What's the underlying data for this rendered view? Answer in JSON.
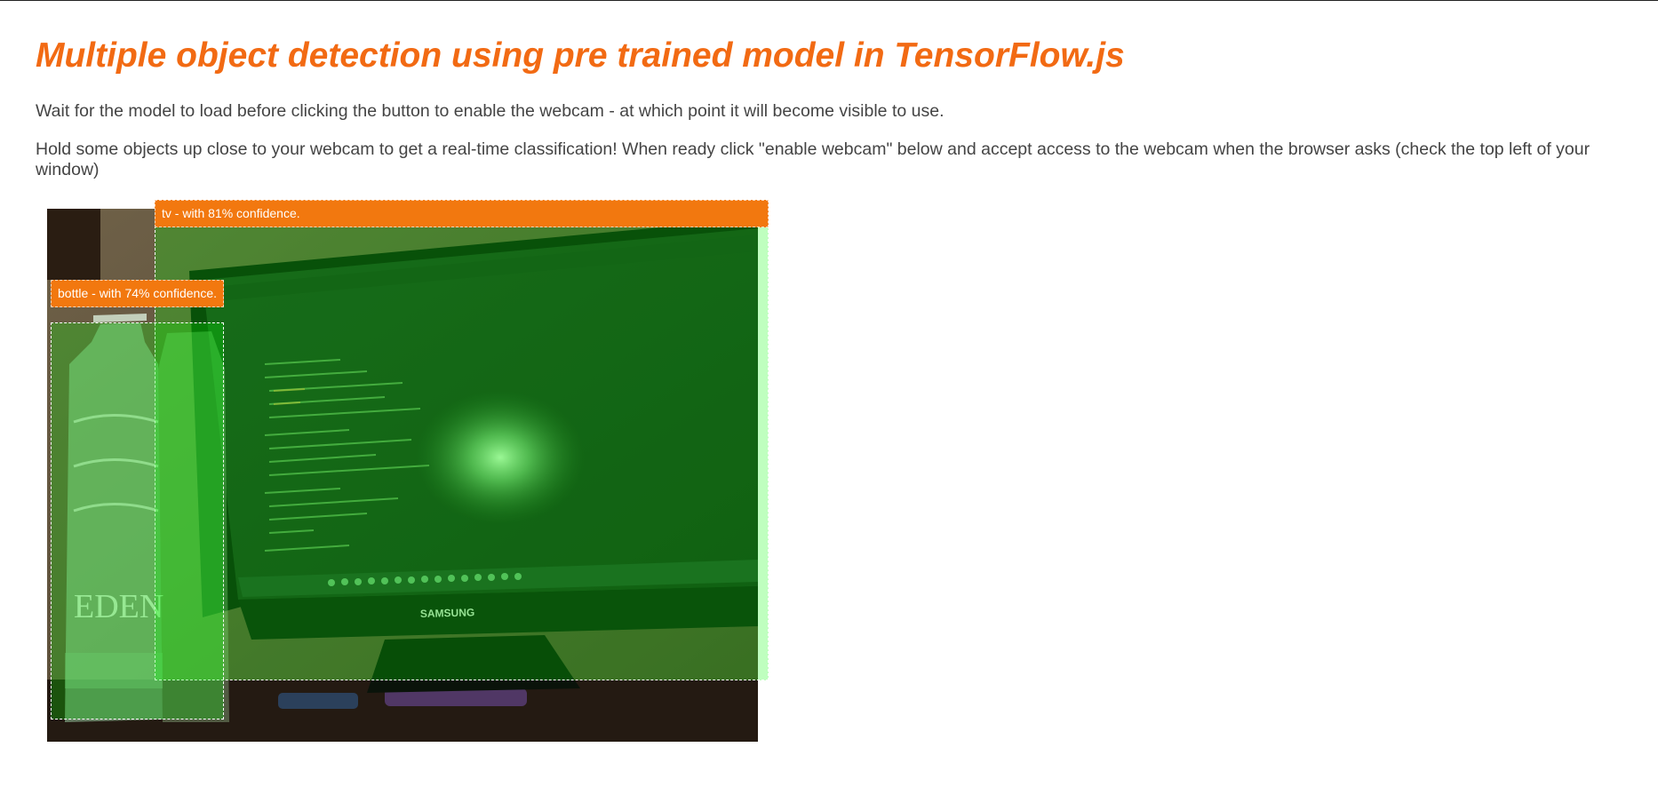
{
  "page": {
    "title": "Multiple object detection using pre trained model in TensorFlow.js",
    "intro": "Wait for the model to load before clicking the button to enable the webcam - at which point it will become visible to use.",
    "instructions": "Hold some objects up close to your webcam to get a real-time classification! When ready click \"enable webcam\" below and accept access to the webcam when the browser asks (check the top left of your window)"
  },
  "colors": {
    "title": "#f26a13",
    "label_background": "#f2780f",
    "highlight_fill": "rgba(0,255,0,0.25)"
  },
  "webcam": {
    "monitor_brand": "SAMSUNG",
    "bottle_brand": "EDEN"
  },
  "detections": [
    {
      "class": "tv",
      "confidence_percent": 81,
      "label": "tv - with 81% confidence."
    },
    {
      "class": "bottle",
      "confidence_percent": 74,
      "label": "bottle - with 74% confidence."
    }
  ]
}
